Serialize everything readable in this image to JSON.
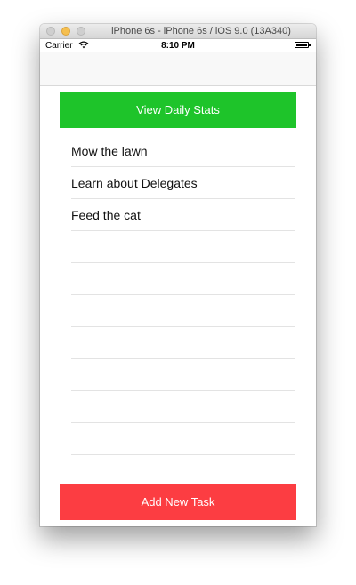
{
  "window": {
    "title": "iPhone 6s - iPhone 6s / iOS 9.0 (13A340)"
  },
  "status_bar": {
    "carrier": "Carrier",
    "time": "8:10 PM",
    "wifi_icon": "wifi-icon",
    "battery_icon": "battery-icon"
  },
  "buttons": {
    "view_stats": "View Daily Stats",
    "add_task": "Add New Task"
  },
  "tasks": [
    {
      "label": "Mow the lawn"
    },
    {
      "label": "Learn about Delegates"
    },
    {
      "label": "Feed the cat"
    },
    {
      "label": ""
    },
    {
      "label": ""
    },
    {
      "label": ""
    },
    {
      "label": ""
    },
    {
      "label": ""
    },
    {
      "label": ""
    },
    {
      "label": ""
    }
  ],
  "colors": {
    "stats_button": "#1ec42a",
    "add_button": "#fc3d42"
  }
}
